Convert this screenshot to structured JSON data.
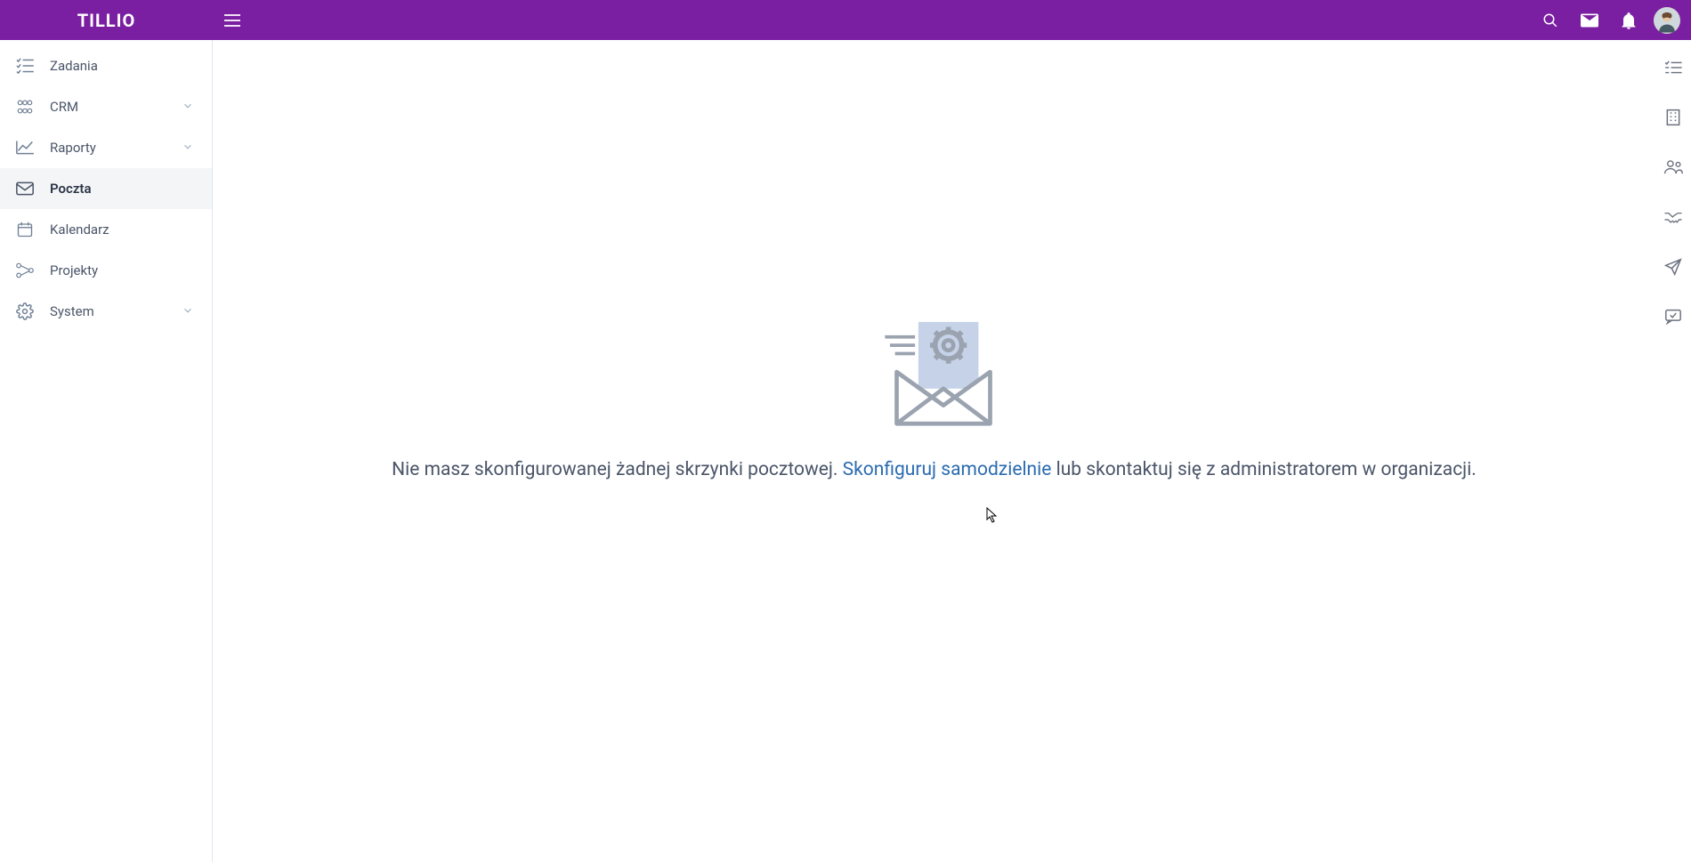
{
  "header": {
    "logo": "TILLIO"
  },
  "sidebar": {
    "items": [
      {
        "label": "Zadania"
      },
      {
        "label": "CRM"
      },
      {
        "label": "Raporty"
      },
      {
        "label": "Poczta"
      },
      {
        "label": "Kalendarz"
      },
      {
        "label": "Projekty"
      },
      {
        "label": "System"
      }
    ]
  },
  "main": {
    "empty_prefix": "Nie masz skonfigurowanej żadnej skrzynki pocztowej. ",
    "empty_link": "Skonfiguruj samodzielnie",
    "empty_suffix": " lub skontaktuj się z administratorem w organizacji."
  }
}
